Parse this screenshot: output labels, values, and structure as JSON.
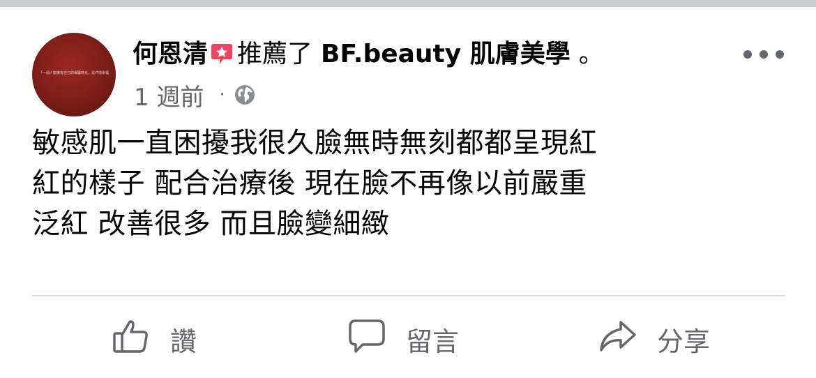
{
  "post": {
    "author": "何恩清",
    "action": "推薦了",
    "page": "BF.beauty 肌膚美學",
    "header_end": "。",
    "time": "1 週前",
    "separator": "·",
    "privacy_icon": "globe-icon",
    "avatar_caption": "「一個人能擁有自己的專屬時光，是件很幸福的事情」",
    "lines": [
      "敏感肌一直困擾我很久臉無時無刻都都呈現紅",
      "紅的樣子  配合治療後 現在臉不再像以前嚴重",
      "泛紅 改善很多 而且臉變細緻"
    ]
  },
  "actions": {
    "like_label": "讚",
    "comment_label": "留言",
    "share_label": "分享"
  },
  "colors": {
    "recommend_icon": "#f3425f",
    "secondary_text": "#65676b",
    "divider": "#dadde1",
    "top_strip": "#c9ccd1"
  }
}
